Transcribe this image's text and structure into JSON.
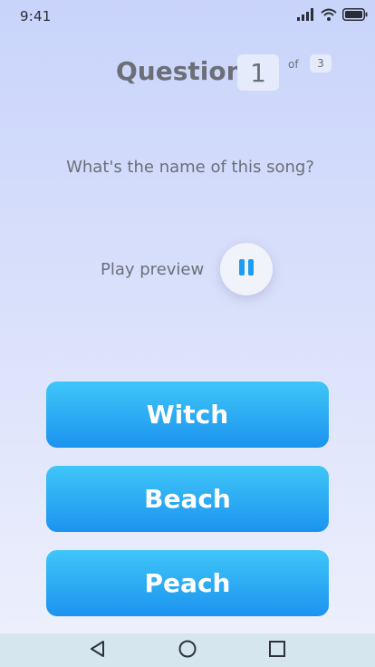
{
  "status_bar": {
    "time": "9:41",
    "icons": [
      "signal-icon",
      "wifi-icon",
      "battery-icon"
    ]
  },
  "question": {
    "label": "Question",
    "number": "1",
    "of_label": "of",
    "total": "3",
    "text": "What's the name of this song?"
  },
  "preview": {
    "label": "Play preview",
    "button_icon": "pause-icon"
  },
  "answers": [
    {
      "label": "Witch"
    },
    {
      "label": "Beach"
    },
    {
      "label": "Peach"
    }
  ],
  "nav": {
    "icons": [
      "back-icon",
      "home-icon",
      "recents-icon"
    ]
  },
  "colors": {
    "background_top": "#c9d4fb",
    "background_bottom": "#eef1fc",
    "button_top": "#3fc6f8",
    "button_bottom": "#1c93ef",
    "pause_icon": "#1e9cf2",
    "nav_bar": "#d5e6ef",
    "text": "#6b6f78"
  }
}
